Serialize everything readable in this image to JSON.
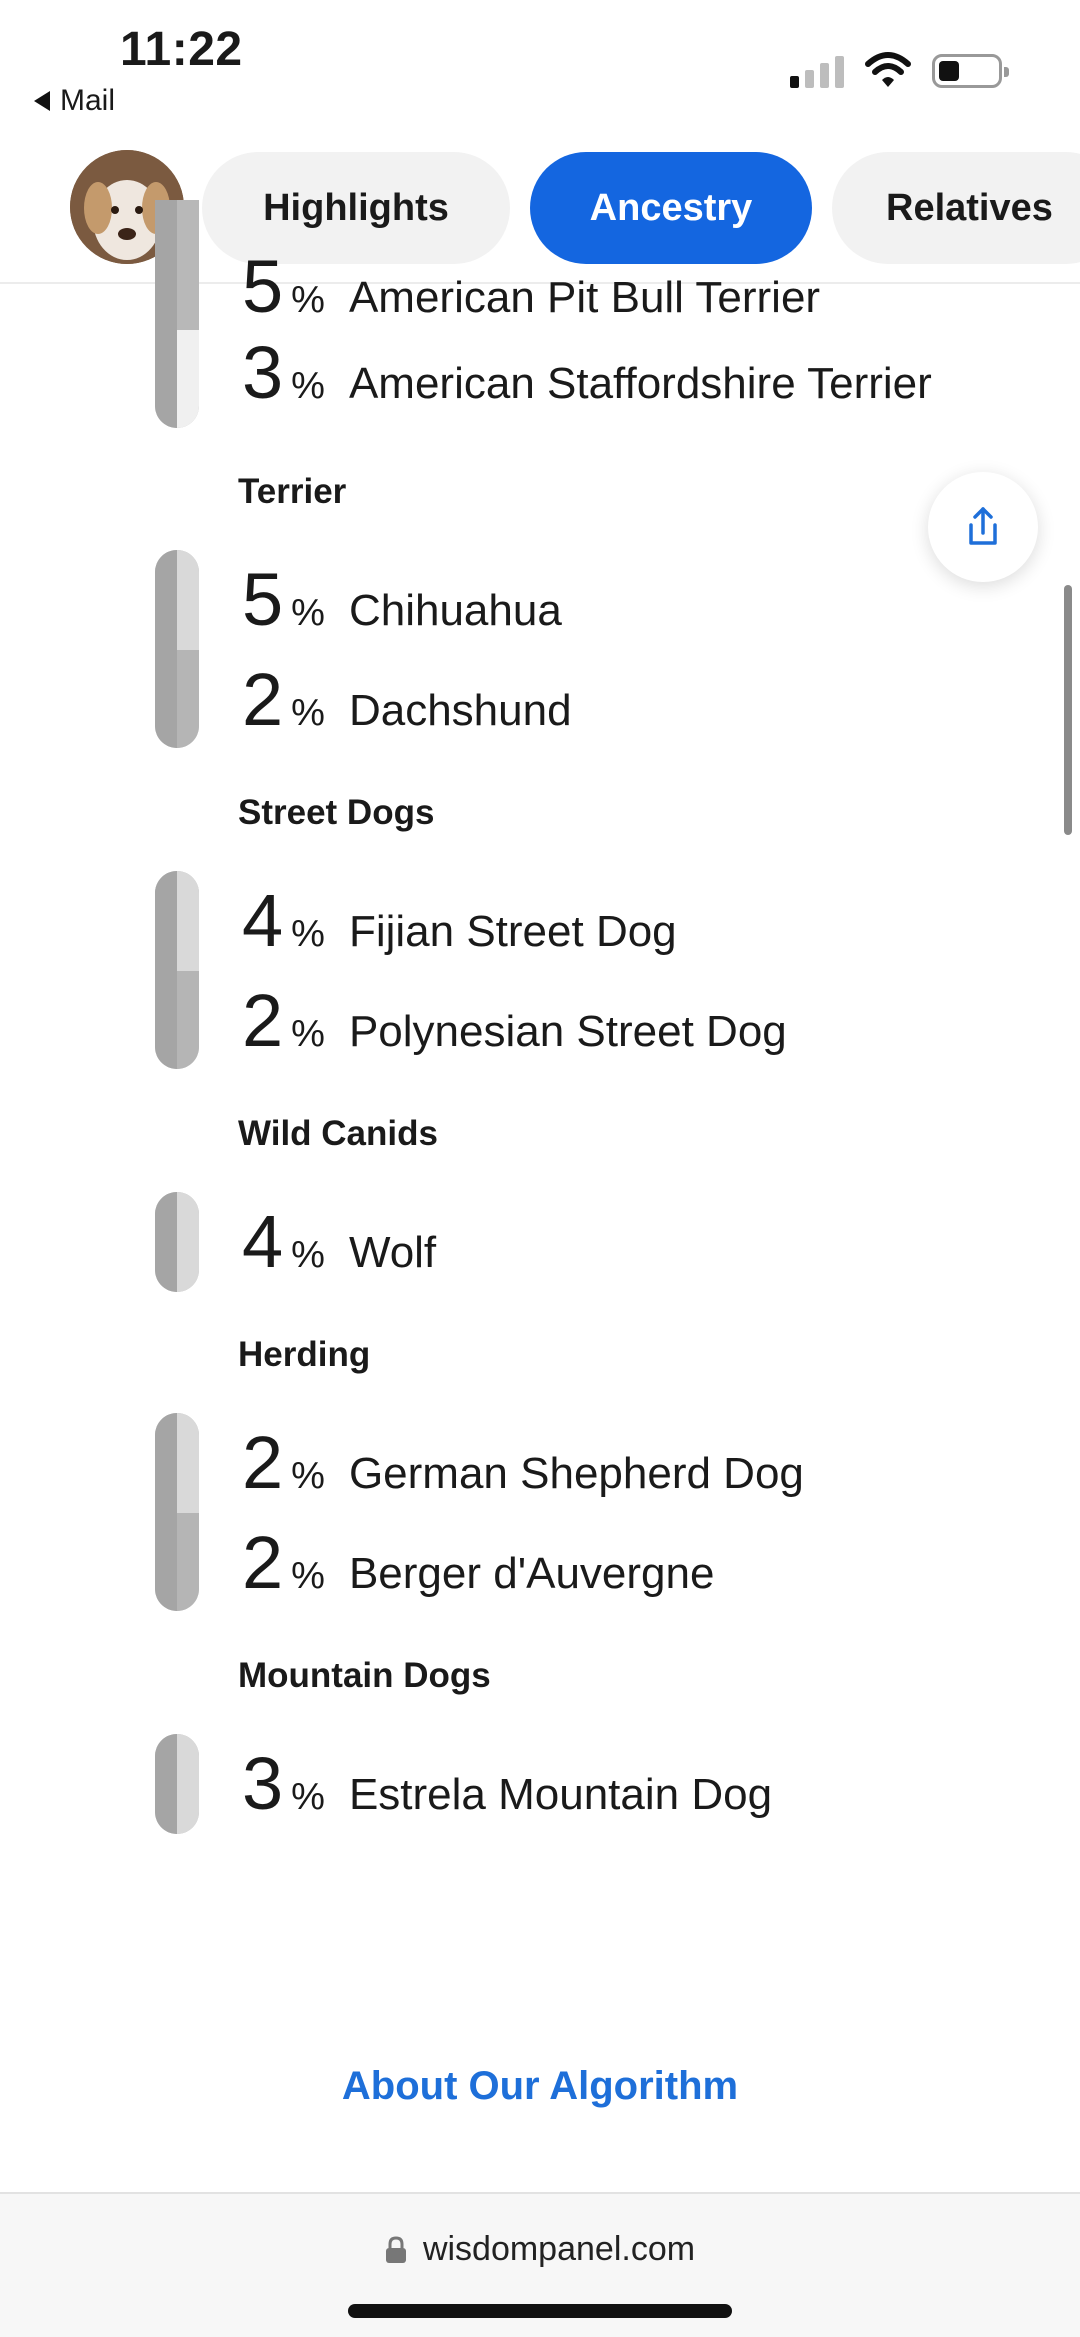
{
  "status_bar": {
    "time": "11:22",
    "back_label": "Mail",
    "signal_icon": "cellular-signal-icon",
    "wifi_icon": "wifi-icon",
    "battery_icon": "battery-icon"
  },
  "header": {
    "avatar_icon": "dog-avatar",
    "tabs": [
      {
        "label": "Highlights",
        "active": false
      },
      {
        "label": "Ancestry",
        "active": true
      },
      {
        "label": "Relatives",
        "active": false
      }
    ]
  },
  "ancestry": {
    "partial_group": {
      "breeds": [
        {
          "percent": "5",
          "name": "American Pit Bull Terrier"
        },
        {
          "percent": "3",
          "name": "American Staffordshire Terrier"
        }
      ]
    },
    "groups": [
      {
        "label": "Terrier",
        "breeds": [
          {
            "percent": "5",
            "name": "Chihuahua"
          },
          {
            "percent": "2",
            "name": "Dachshund"
          }
        ]
      },
      {
        "label": "Street Dogs",
        "breeds": [
          {
            "percent": "4",
            "name": "Fijian Street Dog"
          },
          {
            "percent": "2",
            "name": "Polynesian Street Dog"
          }
        ]
      },
      {
        "label": "Wild Canids",
        "breeds": [
          {
            "percent": "4",
            "name": "Wolf"
          }
        ]
      },
      {
        "label": "Herding",
        "breeds": [
          {
            "percent": "2",
            "name": "German Shepherd Dog"
          },
          {
            "percent": "2",
            "name": "Berger d'Auvergne"
          }
        ]
      },
      {
        "label": "Mountain Dogs",
        "breeds": [
          {
            "percent": "3",
            "name": "Estrela Mountain Dog"
          }
        ]
      }
    ],
    "percent_symbol": "%"
  },
  "share_icon": "share-icon",
  "footer_link": "About Our Algorithm",
  "browser": {
    "url": "wisdompanel.com",
    "lock_icon": "lock-icon"
  },
  "colors": {
    "accent": "#1466e0",
    "link": "#1e6fd9",
    "bar_dark": "#a5a5a5",
    "bar_light": "#d9d9d9"
  }
}
